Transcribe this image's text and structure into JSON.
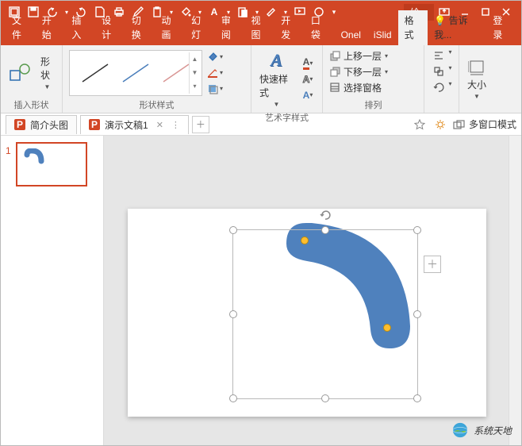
{
  "title_context_tab": "绘...",
  "quick_access": {
    "save": "保存",
    "undo": "撤销",
    "redo": "重做",
    "new": "新建",
    "print": "打印"
  },
  "menu_tabs": [
    "文件",
    "开始",
    "插入",
    "设计",
    "切换",
    "动画",
    "幻灯",
    "审阅",
    "视图",
    "开发",
    "口袋",
    "Onel",
    "iSlid",
    "格式"
  ],
  "menu_active_index": 13,
  "menu_tell_me": "告诉我...",
  "menu_login": "登录",
  "ribbon": {
    "group_insert_shape": {
      "shape_btn": "形状",
      "label": "插入形状"
    },
    "group_shape_styles": {
      "label": "形状样式"
    },
    "group_wordart": {
      "quick_style": "快速样式",
      "label": "艺术字样式"
    },
    "group_arrange": {
      "bring_forward": "上移一层",
      "send_backward": "下移一层",
      "selection_pane": "选择窗格",
      "label": "排列"
    },
    "group_size": {
      "size_btn": "大小"
    }
  },
  "doc_tabs": [
    {
      "name": "简介头图",
      "active": false
    },
    {
      "name": "演示文稿1",
      "active": true
    }
  ],
  "multi_window": "多窗口模式",
  "slide_thumb_number": "1",
  "shape": {
    "fill": "#4f81bd"
  },
  "watermark": "系统天地"
}
